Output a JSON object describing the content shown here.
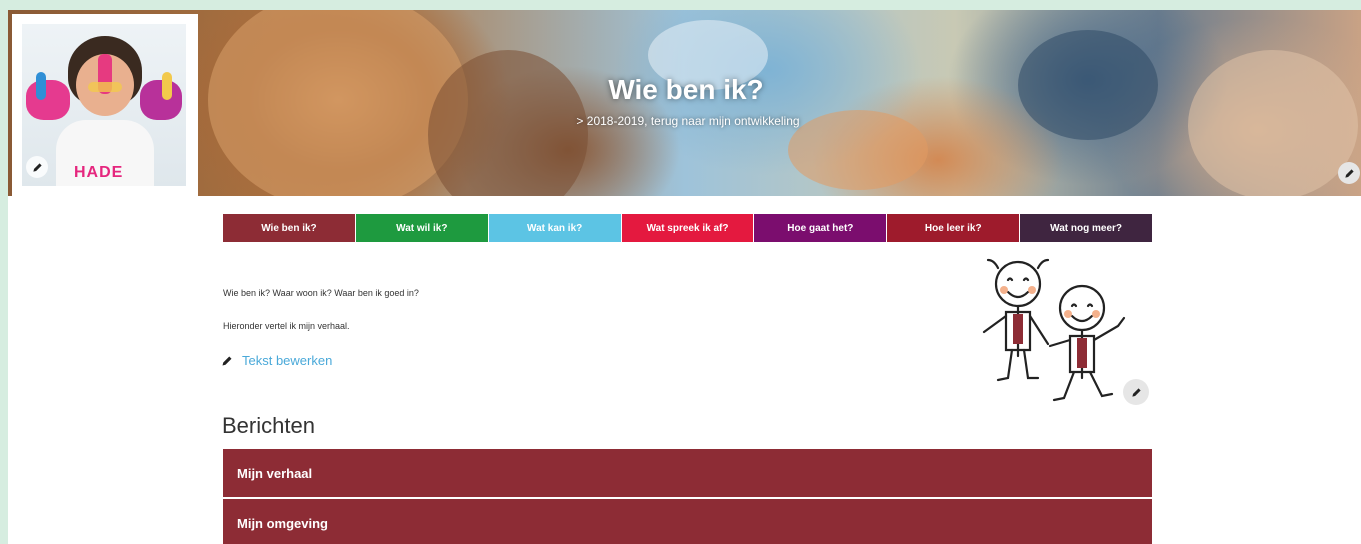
{
  "banner": {
    "title": "Wie ben ik?",
    "subtitle": "> 2018-2019, terug naar mijn ontwikkeling"
  },
  "avatar": {
    "shirt_text": "HADE"
  },
  "tabs": [
    {
      "label": "Wie ben ik?",
      "color": "#8d2c35"
    },
    {
      "label": "Wat wil ik?",
      "color": "#1e9a3f"
    },
    {
      "label": "Wat kan ik?",
      "color": "#5cc4e4"
    },
    {
      "label": "Wat spreek ik af?",
      "color": "#e4193f"
    },
    {
      "label": "Hoe gaat het?",
      "color": "#7b0d6e"
    },
    {
      "label": "Hoe leer ik?",
      "color": "#9e1b2c"
    },
    {
      "label": "Wat nog meer?",
      "color": "#3f2540"
    }
  ],
  "intro": {
    "line1": "Wie ben ik?  Waar woon ik? Waar ben ik goed in?",
    "line2": "Hieronder vertel ik mijn verhaal.",
    "edit_label": "Tekst bewerken"
  },
  "posts": {
    "title": "Berichten",
    "items": [
      {
        "label": "Mijn verhaal"
      },
      {
        "label": "Mijn omgeving"
      }
    ]
  },
  "icons": {
    "edit": "pencil-icon"
  }
}
